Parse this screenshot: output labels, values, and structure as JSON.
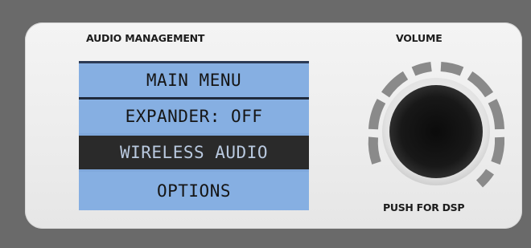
{
  "panel": {
    "audio_title": "AUDIO MANAGEMENT",
    "volume_title": "VOLUME",
    "push_label": "PUSH FOR DSP"
  },
  "menu": {
    "items": [
      {
        "label": "MAIN MENU",
        "selected": false
      },
      {
        "label": "EXPANDER: OFF",
        "selected": false
      },
      {
        "label": "WIRELESS AUDIO",
        "selected": true
      },
      {
        "label": "OPTIONS",
        "selected": false
      }
    ]
  },
  "colors": {
    "lcd_background": "#7fa8dc",
    "selected_background": "#2a2a2a",
    "selected_text": "#b9c9df",
    "panel": "#efefef",
    "frame": "#6a6a6a",
    "knob": "#111111",
    "led_ring": "#8a8a8a"
  },
  "volume": {
    "icon": "volume-knob-icon"
  }
}
